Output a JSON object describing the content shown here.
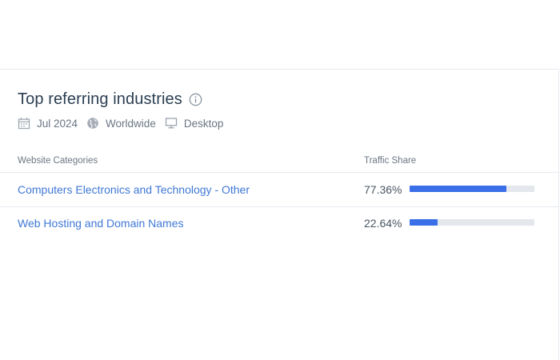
{
  "widget": {
    "title": "Top referring industries",
    "filters": {
      "date": "Jul 2024",
      "region": "Worldwide",
      "device": "Desktop"
    }
  },
  "table": {
    "headers": {
      "category": "Website Categories",
      "share": "Traffic Share"
    },
    "rows": [
      {
        "category": "Computers Electronics and Technology - Other",
        "share_label": "77.36%",
        "share": 0.7736
      },
      {
        "category": "Web Hosting and Domain Names",
        "share_label": "22.64%",
        "share": 0.2264
      }
    ]
  },
  "colors": {
    "accent": "#3a6fe8",
    "link": "#3f78d6",
    "title": "#2a3e52"
  },
  "icons": [
    "info-icon",
    "calendar-icon",
    "globe-icon",
    "desktop-icon"
  ]
}
